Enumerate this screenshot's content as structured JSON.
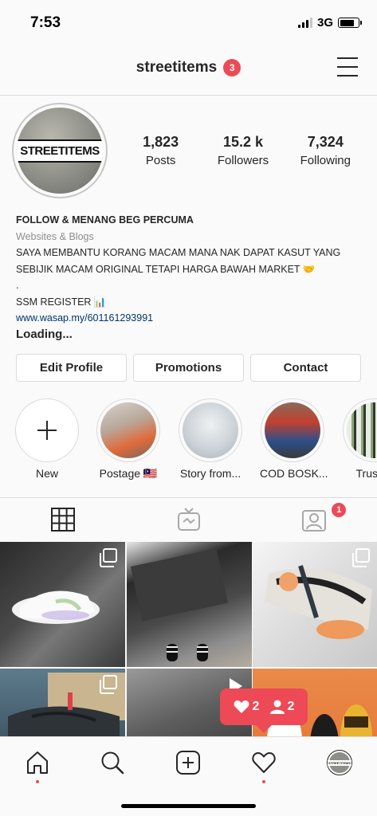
{
  "status_bar": {
    "time": "7:53",
    "network": "3G"
  },
  "header": {
    "username": "streetitems",
    "notification_count": "3"
  },
  "profile": {
    "avatar_text": "STREETITEMS",
    "stats": [
      {
        "value": "1,823",
        "label": "Posts"
      },
      {
        "value": "15.2 k",
        "label": "Followers"
      },
      {
        "value": "7,324",
        "label": "Following"
      }
    ],
    "bio": {
      "name": "FOLLOW & MENANG BEG PERCUMA",
      "category": "Websites & Blogs",
      "line1": "SAYA MEMBANTU KORANG MACAM MANA NAK DAPAT KASUT YANG SEBIJIK MACAM ORIGINAL TETAPI HARGA BAWAH MARKET 🤝",
      "line2": ".",
      "line3": "SSM REGISTER 📊",
      "link": "www.wasap.my/601161293991",
      "loading": "Loading..."
    }
  },
  "actions": {
    "edit": "Edit Profile",
    "promotions": "Promotions",
    "contact": "Contact"
  },
  "highlights": [
    {
      "label": "New"
    },
    {
      "label": "Postage 🇲🇾"
    },
    {
      "label": "Story from..."
    },
    {
      "label": "COD BOSK..."
    },
    {
      "label": "Trusted"
    }
  ],
  "tabs": {
    "tagged_badge": "1"
  },
  "activity": {
    "likes": "2",
    "follows": "2"
  },
  "colors": {
    "accent": "#ed4956",
    "link": "#003569",
    "border": "#dbdbdb"
  }
}
